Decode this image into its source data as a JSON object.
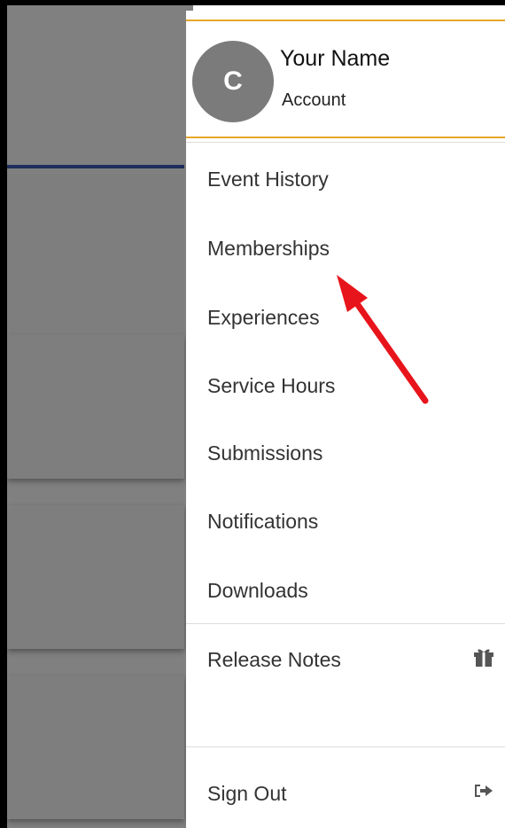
{
  "profile": {
    "initial": "C",
    "name": "Your Name",
    "subtitle": "Account"
  },
  "menu": {
    "items": [
      {
        "label": "Event History"
      },
      {
        "label": "Memberships"
      },
      {
        "label": "Experiences"
      },
      {
        "label": "Service Hours"
      },
      {
        "label": "Submissions"
      },
      {
        "label": "Notifications"
      },
      {
        "label": "Downloads"
      }
    ],
    "release_notes": {
      "label": "Release Notes",
      "icon": "gift-icon"
    },
    "sign_out": {
      "label": "Sign Out",
      "icon": "sign-out-icon"
    }
  },
  "annotation": {
    "color": "#e8141b",
    "points_to": "Memberships"
  },
  "colors": {
    "accent": "#e8a62a",
    "nav_bar": "#1f2d5c",
    "avatar": "#7b7b7b"
  }
}
